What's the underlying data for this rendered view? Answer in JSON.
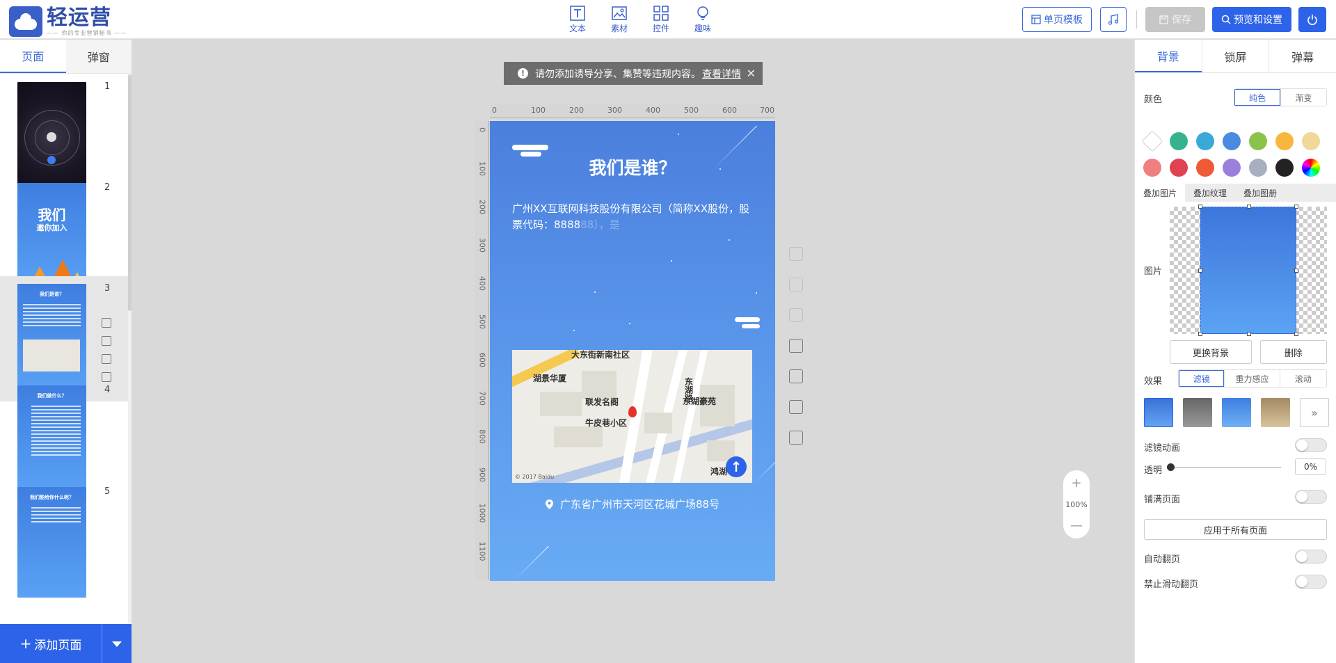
{
  "app": {
    "logo_title": "轻运营",
    "logo_sub": "—— 你的专业营销秘书 ——"
  },
  "toolbar": {
    "tools": [
      {
        "label": "文本",
        "icon": "text-icon"
      },
      {
        "label": "素材",
        "icon": "image-icon"
      },
      {
        "label": "控件",
        "icon": "widgets-icon"
      },
      {
        "label": "趣味",
        "icon": "lightbulb-icon"
      }
    ],
    "template_label": "单页模板",
    "music_icon": "music-icon",
    "save_label": "保存",
    "preview_label": "预览和设置",
    "power_icon": "power-icon"
  },
  "left_panel": {
    "tabs": [
      "页面",
      "弹窗"
    ],
    "active_tab": "页面",
    "pages": [
      {
        "number": "1",
        "title": "",
        "style": "dark"
      },
      {
        "number": "2",
        "title": "我们",
        "subtitle": "邀你加入",
        "style": "blue"
      },
      {
        "number": "3",
        "title": "我们是谁？",
        "style": "blue",
        "selected": true
      },
      {
        "number": "4",
        "title": "我们做什么？",
        "style": "blue"
      },
      {
        "number": "5",
        "title": "我们能给你什么呢？",
        "style": "blue"
      }
    ],
    "add_page_label": "添加页面"
  },
  "notice": {
    "text": "请勿添加诱导分享、集赞等违规内容。",
    "link": "查看详情"
  },
  "ruler": {
    "top": [
      "0",
      "100",
      "200",
      "300",
      "400",
      "500",
      "600",
      "700"
    ],
    "left": [
      "0",
      "100",
      "200",
      "300",
      "400",
      "500",
      "600",
      "700",
      "800",
      "900",
      "1000",
      "1100"
    ]
  },
  "phone": {
    "title": "我们是谁？",
    "para_main": "广州XX互联网科技股份有限公司（简称XX股份，股票代码：8888",
    "para_fade": "88），是",
    "map_labels": {
      "a": "大东街新南社区",
      "b": "湖景华厦",
      "c": "联发名阁",
      "d": "东湖豪苑",
      "e": "牛皮巷小区",
      "f": "东湖路",
      "g": "鸿湖",
      "copyright": "© 2017 Baidu"
    },
    "address": "广东省广州市天河区花城广场88号"
  },
  "zoom": {
    "level": "100%",
    "plus": "+",
    "minus": "—"
  },
  "right_panel": {
    "tabs": [
      "背景",
      "锁屏",
      "弹幕"
    ],
    "active_tab": "背景",
    "color_label": "颜色",
    "color_modes": [
      "纯色",
      "渐变"
    ],
    "swatches": [
      "#ffffff",
      "#35b38f",
      "#3aa9da",
      "#4a8ae0",
      "#8bc34a",
      "#f6b73c",
      "#efd898",
      "#f08080",
      "#e04252",
      "#ef5a36",
      "#9a7fdb",
      "#a8b0bf",
      "#222222",
      "rainbow"
    ],
    "overlay_tabs": [
      "叠加图片",
      "叠加纹理",
      "叠加图册"
    ],
    "image_label": "图片",
    "change_bg_label": "更换背景",
    "delete_label": "删除",
    "effect_label": "效果",
    "effect_modes": [
      "滤镜",
      "重力感应",
      "滚动"
    ],
    "filter_more": "»",
    "filter_anim_label": "滤镜动画",
    "opacity_label": "透明",
    "opacity_value": "0%",
    "fill_page_label": "铺满页面",
    "apply_all_label": "应用于所有页面",
    "auto_flip_label": "自动翻页",
    "no_swipe_label": "禁止滑动翻页"
  }
}
